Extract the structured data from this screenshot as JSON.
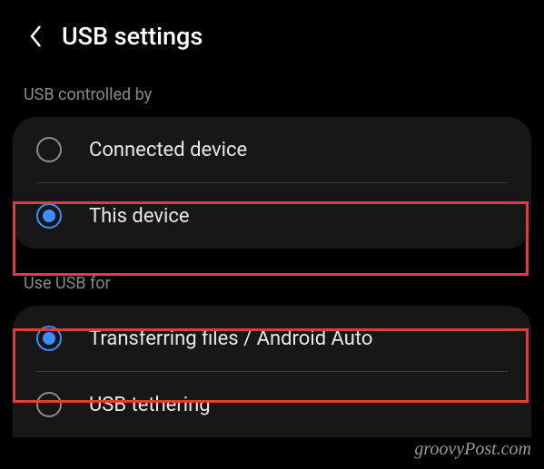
{
  "header": {
    "title": "USB settings"
  },
  "sections": {
    "controlled_by": {
      "header": "USB controlled by",
      "options": {
        "connected": "Connected device",
        "this": "This device"
      }
    },
    "use_for": {
      "header": "Use USB for",
      "options": {
        "transfer": "Transferring files / Android Auto",
        "tethering": "USB tethering"
      }
    }
  },
  "watermark": "groovyPost.com"
}
